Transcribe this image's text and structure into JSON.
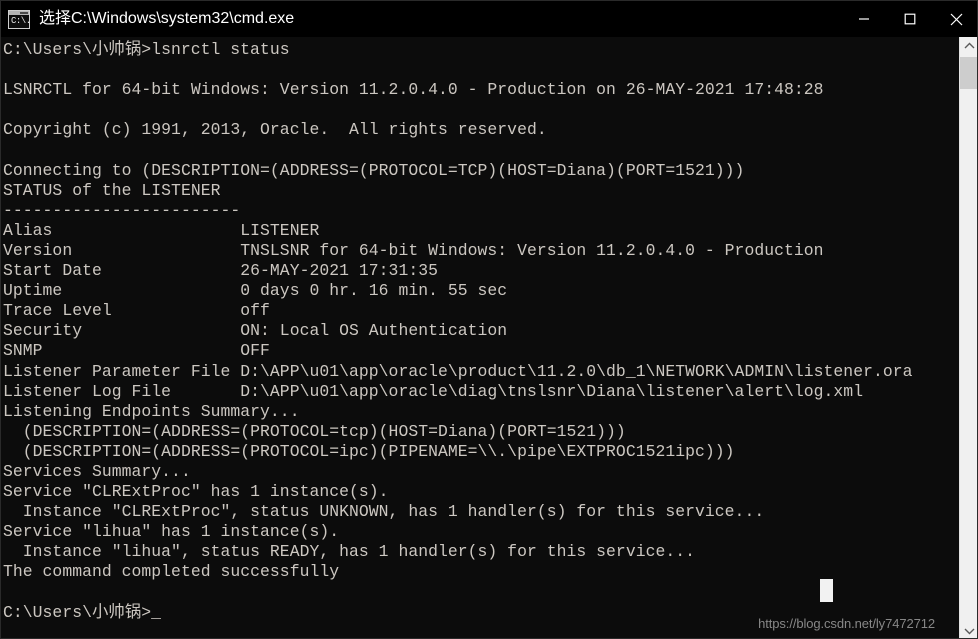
{
  "window": {
    "title": "选择C:\\Windows\\system32\\cmd.exe",
    "icon_glyph": "C:\\.",
    "icon_name": "cmd-icon",
    "background_color": "#0c0c0c",
    "titlebar_color": "#000000",
    "text_color": "#ccc7c1",
    "controls": {
      "minimize_label": "Minimize",
      "maximize_label": "Maximize",
      "close_label": "Close"
    }
  },
  "console": {
    "prompt_command": "C:\\Users\\小帅锅>lsnrctl status",
    "banner": "LSNRCTL for 64-bit Windows: Version 11.2.0.4.0 - Production on 26-MAY-2021 17:48:28",
    "copyright": "Copyright (c) 1991, 2013, Oracle.  All rights reserved.",
    "connecting": "Connecting to (DESCRIPTION=(ADDRESS=(PROTOCOL=TCP)(HOST=Diana)(PORT=1521)))",
    "status_header": "STATUS of the LISTENER",
    "separator": "------------------------",
    "fields": [
      {
        "key": "Alias",
        "value": "LISTENER"
      },
      {
        "key": "Version",
        "value": "TNSLSNR for 64-bit Windows: Version 11.2.0.4.0 - Production"
      },
      {
        "key": "Start Date",
        "value": "26-MAY-2021 17:31:35"
      },
      {
        "key": "Uptime",
        "value": "0 days 0 hr. 16 min. 55 sec"
      },
      {
        "key": "Trace Level",
        "value": "off"
      },
      {
        "key": "Security",
        "value": "ON: Local OS Authentication"
      },
      {
        "key": "SNMP",
        "value": "OFF"
      },
      {
        "key": "Listener Parameter File",
        "value": "D:\\APP\\u01\\app\\oracle\\product\\11.2.0\\db_1\\NETWORK\\ADMIN\\listener.ora"
      },
      {
        "key": "Listener Log File",
        "value": "D:\\APP\\u01\\app\\oracle\\diag\\tnslsnr\\Diana\\listener\\alert\\log.xml"
      }
    ],
    "endpoints_header": "Listening Endpoints Summary...",
    "endpoints": [
      "  (DESCRIPTION=(ADDRESS=(PROTOCOL=tcp)(HOST=Diana)(PORT=1521)))",
      "  (DESCRIPTION=(ADDRESS=(PROTOCOL=ipc)(PIPENAME=\\\\.\\pipe\\EXTPROC1521ipc)))"
    ],
    "services_header": "Services Summary...",
    "services": [
      "Service \"CLRExtProc\" has 1 instance(s).",
      "  Instance \"CLRExtProc\", status UNKNOWN, has 1 handler(s) for this service...",
      "Service \"lihua\" has 1 instance(s).",
      "  Instance \"lihua\", status READY, has 1 handler(s) for this service..."
    ],
    "completion": "The command completed successfully",
    "final_prompt": "C:\\Users\\小帅锅>",
    "cursor": "_"
  },
  "watermark": {
    "text": "https://blog.csdn.net/ly7472712"
  },
  "scrollbar": {
    "up_arrow": "︿",
    "down_arrow": "﹀"
  }
}
